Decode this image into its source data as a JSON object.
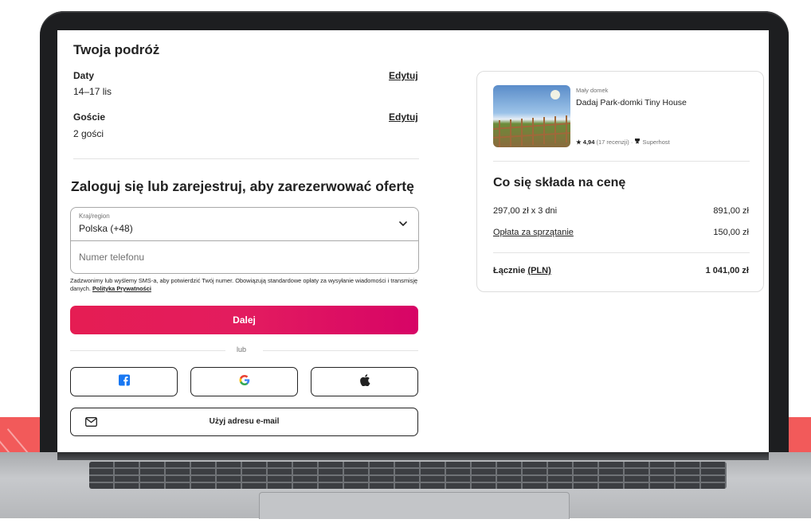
{
  "trip": {
    "title": "Twoja podróż",
    "dates_label": "Daty",
    "dates_value": "14–17 lis",
    "guests_label": "Goście",
    "guests_value": "2 gości",
    "edit_label": "Edytuj"
  },
  "login": {
    "title": "Zaloguj się lub zarejestruj, aby zarezerwować ofertę",
    "country_label": "Kraj/region",
    "country_value": "Polska (+48)",
    "phone_placeholder": "Numer telefonu",
    "sms_note": "Zadzwonimy lub wyślemy SMS-a, aby potwierdzić Twój numer. Obowiązują standardowe opłaty za wysyłanie wiadomości i transmisję danych.",
    "privacy_link": "Polityka Prywatności",
    "continue_label": "Dalej",
    "or_label": "lub",
    "email_label": "Użyj adresu e-mail"
  },
  "listing": {
    "type": "Mały domek",
    "name": "Dadaj Park-domki Tiny House",
    "rating": "★ 4,94",
    "reviews": "(17 recenzji)",
    "separator": "·",
    "host_badge": "Superhost"
  },
  "price": {
    "title": "Co się składa na cenę",
    "nights_label": "297,00 zł x 3 dni",
    "nights_value": "891,00 zł",
    "cleaning_label": "Opłata za sprzątanie",
    "cleaning_value": "150,00 zł",
    "total_label": "Łącznie",
    "total_currency": "(PLN)",
    "total_value": "1 041,00 zł"
  },
  "colors": {
    "accent": "#e31c5f",
    "background_band": "#f25a5a",
    "facebook": "#1877f2"
  },
  "icons": {
    "facebook": "facebook-icon",
    "google": "google-icon",
    "apple": "apple-icon",
    "email": "envelope-icon",
    "dropdown": "chevron-down-icon",
    "star": "star-icon",
    "superhost": "trophy-icon"
  }
}
